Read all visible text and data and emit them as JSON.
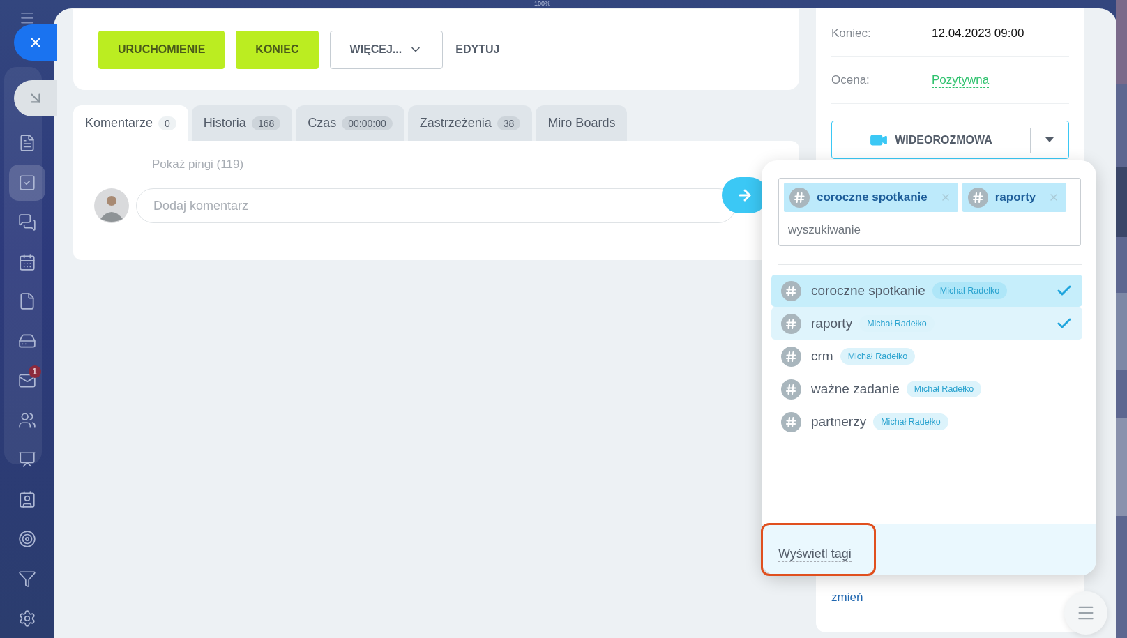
{
  "zoom_label": "100%",
  "sidebar": {
    "items": [
      {
        "kind": "document",
        "selected": false
      },
      {
        "kind": "tasks",
        "selected": true
      },
      {
        "kind": "chats",
        "selected": false
      },
      {
        "kind": "calendar",
        "selected": false
      },
      {
        "kind": "file",
        "selected": false
      },
      {
        "kind": "drive",
        "selected": false
      },
      {
        "kind": "mail",
        "selected": false,
        "badge": "1"
      },
      {
        "kind": "users",
        "selected": false
      },
      {
        "kind": "board",
        "selected": false
      },
      {
        "kind": "contact",
        "selected": false
      },
      {
        "kind": "target",
        "selected": false
      },
      {
        "kind": "funnel",
        "selected": false
      },
      {
        "kind": "settings",
        "selected": false
      }
    ]
  },
  "actions": [
    {
      "label": "URUCHOMIENIE",
      "kind": "primary"
    },
    {
      "label": "KONIEC",
      "kind": "primary"
    },
    {
      "label": "WIĘCEJ...",
      "kind": "dropdown"
    },
    {
      "label": "EDYTUJ",
      "kind": "link"
    }
  ],
  "tabs": [
    {
      "label": "Komentarze",
      "count": "0",
      "selected": true
    },
    {
      "label": "Historia",
      "count": "168",
      "selected": false
    },
    {
      "label": "Czas",
      "count": "00:00:00",
      "selected": false
    },
    {
      "label": "Zastrzeżenia",
      "count": "38",
      "selected": false
    },
    {
      "label": "Miro Boards",
      "selected": false
    }
  ],
  "comments": {
    "pings_link": "Pokaż pingi (119)",
    "placeholder": "Dodaj komentarz"
  },
  "details": [
    {
      "label": "Koniec:",
      "value": "12.04.2023 09:00",
      "kind": "plain"
    },
    {
      "label": "Ocena:",
      "value": "Pozytywna",
      "kind": "rating"
    }
  ],
  "video_button": {
    "label": "WIDEOROZMOWA"
  },
  "tags_change_link": "zmień",
  "tag_popup": {
    "chips": [
      {
        "label": "coroczne spotkanie"
      },
      {
        "label": "raporty"
      }
    ],
    "search_placeholder": "wyszukiwanie",
    "items": [
      {
        "name": "coroczne spotkanie",
        "owner": "Michał Radełko",
        "selected": true,
        "hovered": true
      },
      {
        "name": "raporty",
        "owner": "Michał Radełko",
        "selected": true,
        "hovered": false
      },
      {
        "name": "crm",
        "owner": "Michał Radełko",
        "selected": false,
        "hovered": false
      },
      {
        "name": "ważne zadanie",
        "owner": "Michał Radełko",
        "selected": false,
        "hovered": false
      },
      {
        "name": "partnerzy",
        "owner": "Michał Radełko",
        "selected": false,
        "hovered": false
      }
    ],
    "footer_link": "Wyświetl tagi",
    "footer_highlighted": true
  }
}
